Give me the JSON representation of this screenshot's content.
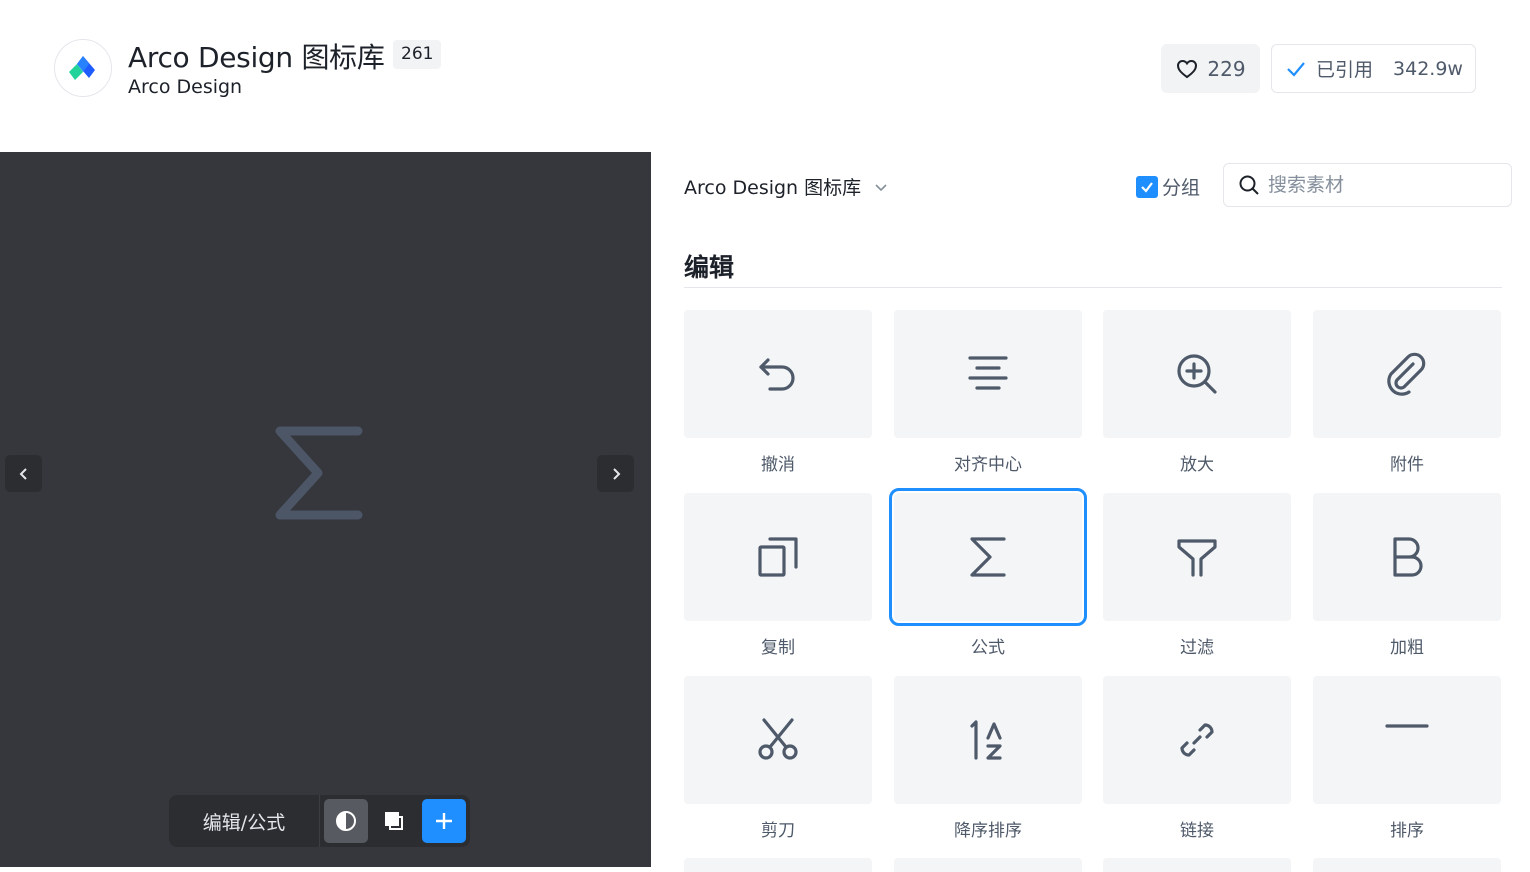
{
  "header": {
    "title": "Arco Design 图标库",
    "count": "261",
    "subtitle": "Arco Design",
    "likes": "229",
    "cited_label": "已引用",
    "cited_count": "342.9w"
  },
  "preview": {
    "path_label": "编辑/公式",
    "icon": "sigma-icon"
  },
  "filter": {
    "library": "Arco Design 图标库",
    "group_label": "分组",
    "search_placeholder": "搜索素材"
  },
  "section": {
    "title": "编辑"
  },
  "icons": [
    {
      "label": "撤消",
      "icon": "undo-icon"
    },
    {
      "label": "对齐中心",
      "icon": "align-center-icon"
    },
    {
      "label": "放大",
      "icon": "zoom-in-icon"
    },
    {
      "label": "附件",
      "icon": "attachment-icon"
    },
    {
      "label": "复制",
      "icon": "copy-icon"
    },
    {
      "label": "公式",
      "icon": "formula-icon"
    },
    {
      "label": "过滤",
      "icon": "filter-icon"
    },
    {
      "label": "加粗",
      "icon": "bold-icon"
    },
    {
      "label": "剪刀",
      "icon": "scissor-icon"
    },
    {
      "label": "降序排序",
      "icon": "sort-descending-icon"
    },
    {
      "label": "链接",
      "icon": "link-icon"
    },
    {
      "label": "排序",
      "icon": "sort-icon"
    }
  ],
  "selected_index": 5,
  "colors": {
    "accent": "#1f8fff",
    "icon_stroke": "#4e5969",
    "preview_bg": "#35373c"
  }
}
